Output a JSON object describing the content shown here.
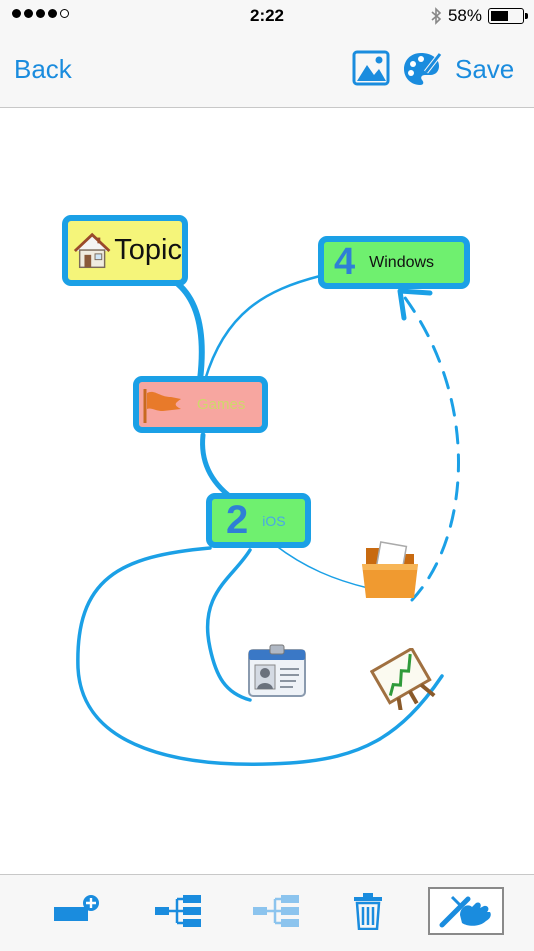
{
  "status_bar": {
    "time": "2:22",
    "battery_text": "58%",
    "battery_level": 0.58,
    "signal_bars_filled": 4,
    "signal_bars_total": 5,
    "bluetooth_icon": "bluetooth-icon"
  },
  "nav": {
    "back_label": "Back",
    "save_label": "Save",
    "image_icon": "image-icon",
    "palette_icon": "palette-icon"
  },
  "mindmap": {
    "nodes": [
      {
        "id": "topic",
        "label": "Topic",
        "icon": "house-icon",
        "fill": "#f5f57a"
      },
      {
        "id": "windows",
        "badge": "4",
        "label": "Windows",
        "fill": "#6ff06f"
      },
      {
        "id": "games",
        "label": "Games",
        "icon": "flag-icon",
        "fill": "#f7a6a0"
      },
      {
        "id": "ios",
        "badge": "2",
        "label": "iOS",
        "fill": "#6ff06f"
      }
    ],
    "images": [
      "folder-icon",
      "id-card-icon",
      "chart-easel-icon"
    ],
    "colors": {
      "branch": "#1ba0e6",
      "node_border": "#1ba0e6"
    }
  },
  "toolbar": {
    "items": [
      "add-node-icon",
      "add-child-icon",
      "add-sibling-icon",
      "trash-icon",
      "edit-mode-icon"
    ]
  }
}
